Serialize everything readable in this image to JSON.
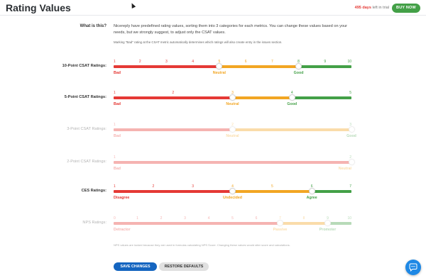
{
  "header": {
    "title": "Rating Values",
    "trial_days": "495 days",
    "trial_suffix": " left in trial",
    "buy_label": "BUY NOW"
  },
  "info": {
    "label": "What is this?",
    "text": "Nicereply have predefined rating values, sorting them into 3 categories for each metrics. You can change these values based on your needs, but we strongly suggest, to adjust only the CSAT values.",
    "note": "Marking \"Bad\" rating at the CSAT metric automatically determines which ratings will also create entry in the issues section."
  },
  "colors": {
    "bad": "#e53935",
    "neutral": "#f2a623",
    "good": "#43a047",
    "track_grey": "#e6e6e6"
  },
  "rows": [
    {
      "label": "10-Point CSAT Ratings:",
      "faded": false,
      "numbers": [
        "1",
        "2",
        "3",
        "4",
        "5",
        "6",
        "7",
        "8",
        "9",
        "10"
      ],
      "categories": [
        "Bad",
        "Neutral",
        "Good"
      ],
      "bad_end": 4,
      "neutral_end": 7
    },
    {
      "label": "5-Point CSAT Ratings:",
      "faded": false,
      "numbers": [
        "1",
        "2",
        "3",
        "4",
        "5"
      ],
      "categories": [
        "Bad",
        "Neutral",
        "Good"
      ],
      "bad_end": 2,
      "neutral_end": 3
    },
    {
      "label": "3-Point CSAT Ratings:",
      "faded": true,
      "numbers": [
        "1",
        "2",
        "3"
      ],
      "categories": [
        "Bad",
        "Neutral",
        "Good"
      ],
      "bad_end": 1,
      "neutral_end": 2
    },
    {
      "label": "2-Point CSAT Ratings:",
      "faded": true,
      "numbers": [
        "1",
        "2"
      ],
      "categories": [
        "Bad",
        "Neutral"
      ],
      "bad_end": 1,
      "neutral_end": 1
    },
    {
      "label": "CES Ratings:",
      "faded": false,
      "numbers": [
        "1",
        "2",
        "3",
        "4",
        "5",
        "6",
        "7"
      ],
      "categories": [
        "Disagree",
        "Undecided",
        "Agree"
      ],
      "bad_end": 3,
      "neutral_end": 5
    },
    {
      "label": "NPS Ratings:",
      "faded": true,
      "numbers": [
        "0",
        "1",
        "2",
        "3",
        "4",
        "5",
        "6",
        "7",
        "8",
        "9",
        "10"
      ],
      "categories": [
        "Detractor",
        "Passive",
        "Promoter"
      ],
      "bad_end": 7,
      "neutral_end": 9
    }
  ],
  "nps_note": "NPS values are locked because they are used in formulas calculating NPS Score. Changing these values would alter score and calculations.",
  "buttons": {
    "save": "SAVE CHANGES",
    "restore": "RESTORE DEFAULTS"
  }
}
